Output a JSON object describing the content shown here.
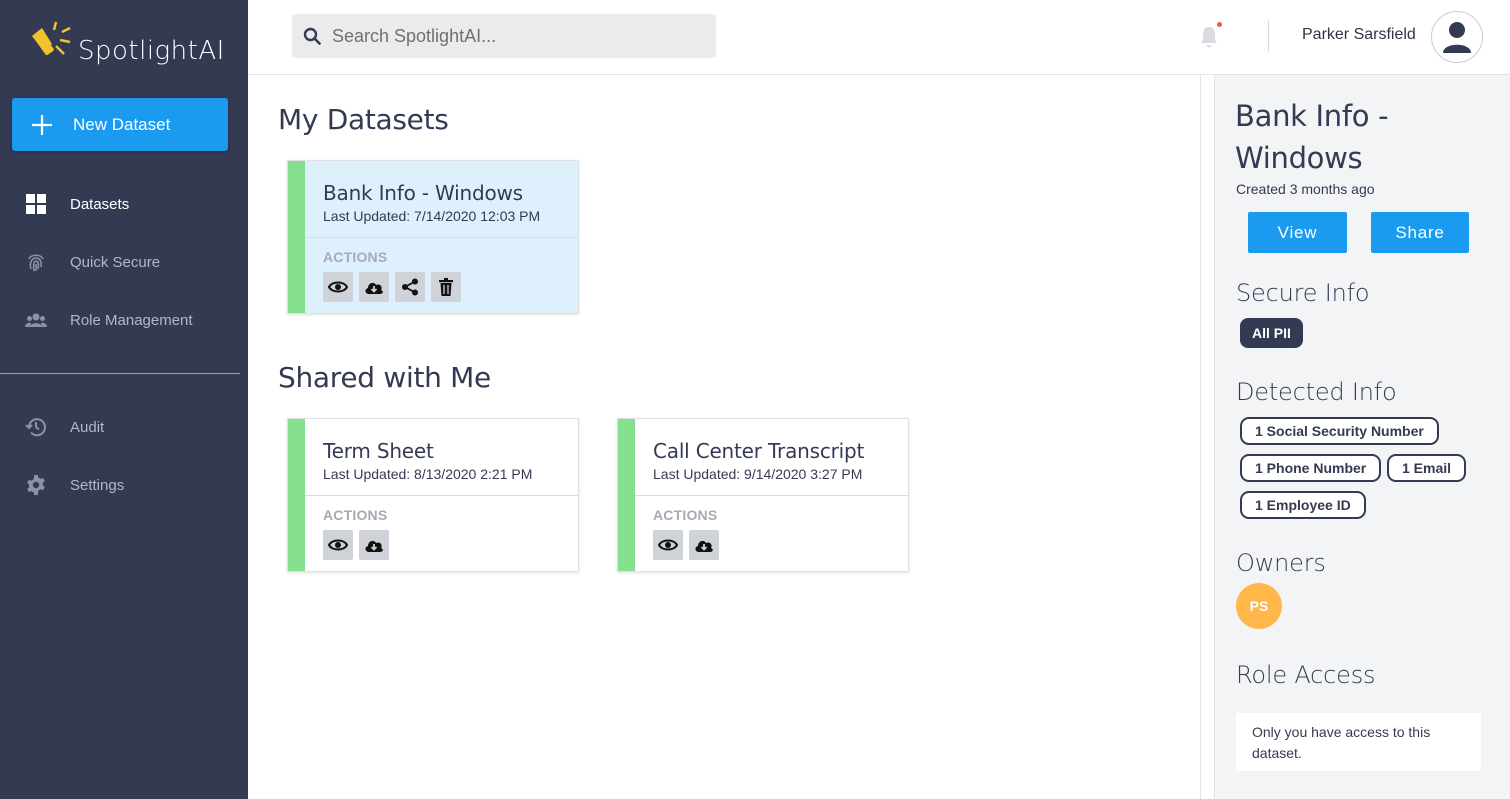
{
  "app": {
    "name": "SpotlightAI"
  },
  "sidebar": {
    "new_button": "New Dataset",
    "items": [
      {
        "label": "Datasets",
        "icon": "grid-icon",
        "active": true
      },
      {
        "label": "Quick Secure",
        "icon": "fingerprint-icon",
        "active": false
      },
      {
        "label": "Role Management",
        "icon": "people-icon",
        "active": false
      },
      {
        "label": "Audit",
        "icon": "history-icon",
        "active": false
      },
      {
        "label": "Settings",
        "icon": "gear-icon",
        "active": false
      }
    ]
  },
  "header": {
    "search_placeholder": "Search SpotlightAI...",
    "user_name": "Parker Sarsfield"
  },
  "main": {
    "my_datasets_title": "My Datasets",
    "shared_title": "Shared with Me",
    "actions_label": "ACTIONS",
    "my_datasets": [
      {
        "title": "Bank Info - Windows",
        "updated": "Last Updated: 7/14/2020 12:03 PM",
        "actions": [
          "view",
          "download",
          "share",
          "delete"
        ],
        "selected": true
      }
    ],
    "shared": [
      {
        "title": "Term Sheet",
        "updated": "Last Updated: 8/13/2020 2:21 PM",
        "actions": [
          "view",
          "download"
        ]
      },
      {
        "title": "Call Center Transcript",
        "updated": "Last Updated: 9/14/2020 3:27 PM",
        "actions": [
          "view",
          "download"
        ]
      }
    ]
  },
  "detail": {
    "title": "Bank Info - Windows",
    "created": "Created 3 months ago",
    "view_button": "View",
    "share_button": "Share",
    "secure_info_heading": "Secure Info",
    "secure_info_tags": [
      "All PII"
    ],
    "detected_heading": "Detected Info",
    "detected_tags": [
      "1 Social Security Number",
      "1 Phone Number",
      "1 Email",
      "1 Employee ID"
    ],
    "owners_heading": "Owners",
    "owner_initials": "PS",
    "role_access_heading": "Role Access",
    "role_access_text": "Only you have access to this dataset."
  },
  "colors": {
    "sidebar": "#353a53",
    "accent": "#1a9bf0",
    "stripe": "#85e08e",
    "owner": "#ffb74a"
  }
}
